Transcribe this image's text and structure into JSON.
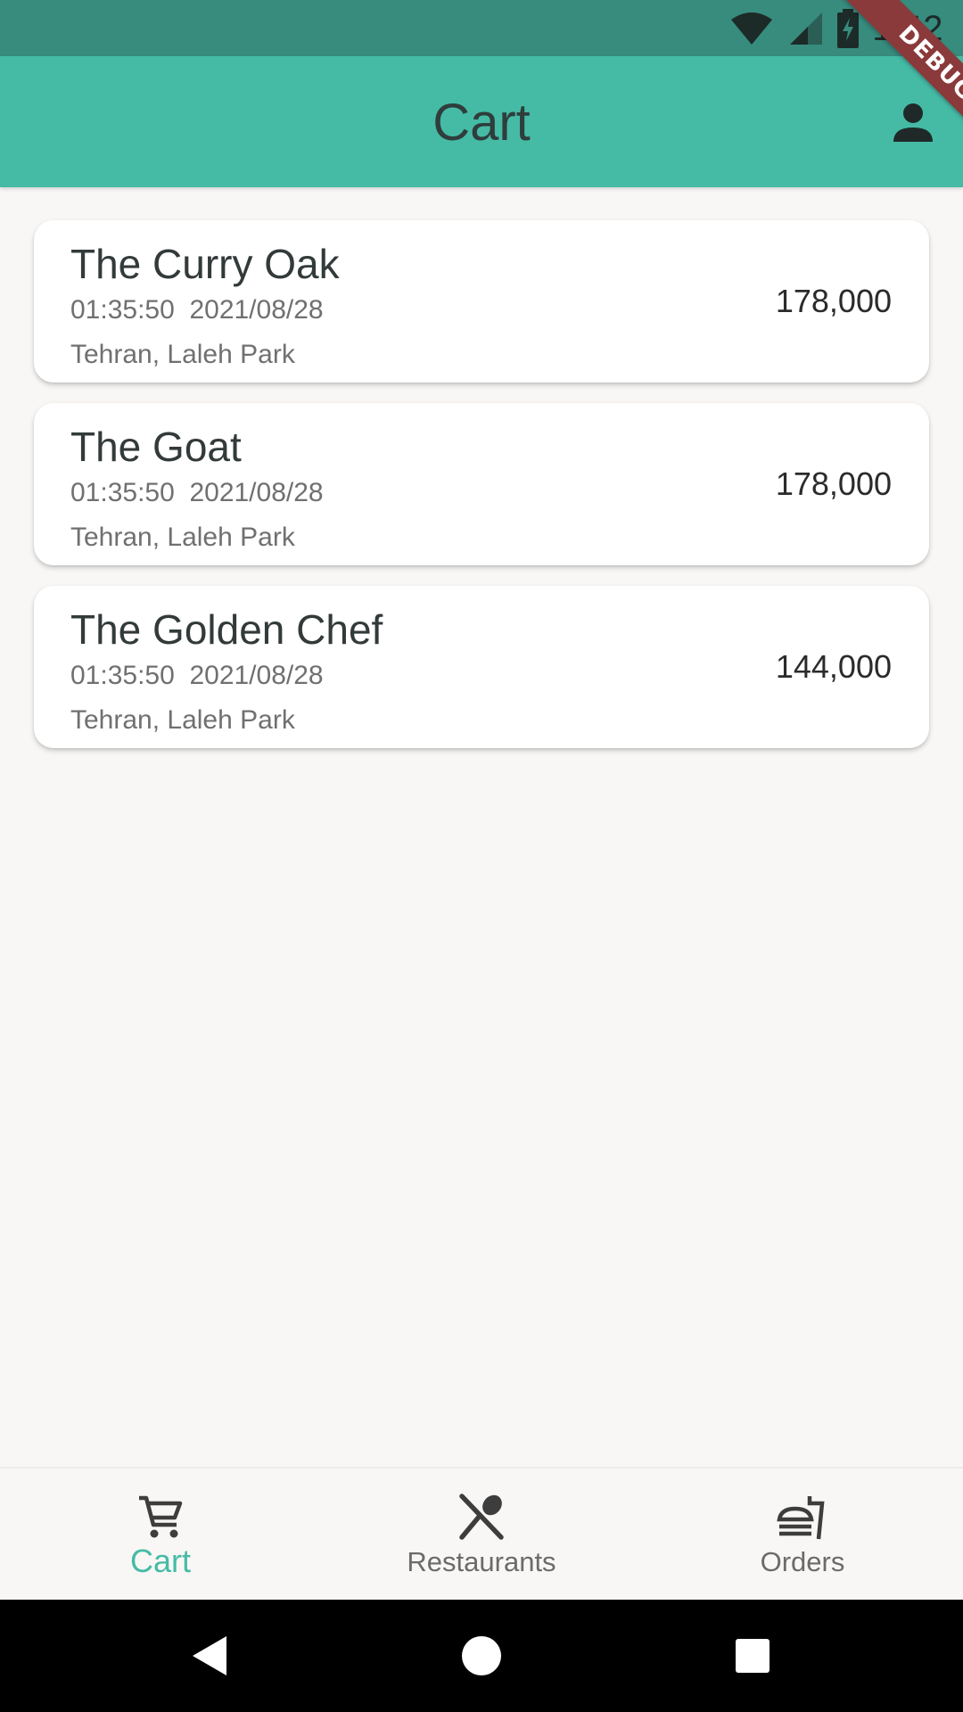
{
  "status_bar": {
    "time": "1:42"
  },
  "debug_banner": "DEBUG",
  "app_bar": {
    "title": "Cart"
  },
  "cart": {
    "items": [
      {
        "name": "The Curry Oak",
        "datetime": "01:35:50  2021/08/28",
        "address": "Tehran, Laleh Park",
        "price": "178,000"
      },
      {
        "name": "The Goat",
        "datetime": "01:35:50  2021/08/28",
        "address": "Tehran, Laleh Park",
        "price": "178,000"
      },
      {
        "name": "The Golden Chef",
        "datetime": "01:35:50  2021/08/28",
        "address": "Tehran, Laleh Park",
        "price": "144,000"
      }
    ]
  },
  "bottom_nav": {
    "items": [
      {
        "label": "Cart",
        "icon": "cart-icon",
        "active": true
      },
      {
        "label": "Restaurants",
        "icon": "utensils-icon",
        "active": false
      },
      {
        "label": "Orders",
        "icon": "fastfood-icon",
        "active": false
      }
    ]
  },
  "colors": {
    "primary": "#45bba6",
    "status_bar": "#378c7e",
    "background": "#f8f7f5"
  }
}
